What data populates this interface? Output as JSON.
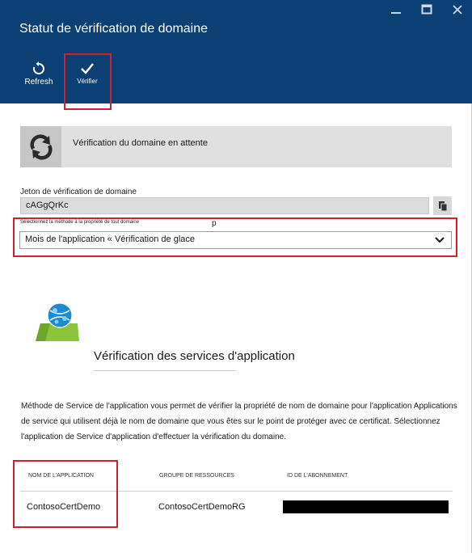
{
  "window": {
    "title": "Statut de vérification de domaine",
    "minimize_icon": "minimize-icon",
    "maximize_icon": "maximize-icon",
    "close_icon": "close-icon"
  },
  "toolbar": {
    "refresh_label": "Refresh",
    "refresh_icon": "refresh-icon",
    "verify_label": "Vérifier",
    "verify_icon": "checkmark-icon"
  },
  "status": {
    "icon": "sync-icon",
    "text": "Vérification du domaine en attente"
  },
  "token": {
    "label": "Jeton de vérification de domaine",
    "value": "cAGgQrKc",
    "copy_icon": "copy-icon"
  },
  "method": {
    "label": "Sélectionnez la méthode à la propriété de tout domaine",
    "stray_char": "p",
    "selected": "Mois de l'application « Vérification de glace",
    "chevron_icon": "chevron-down-icon"
  },
  "service": {
    "icon": "app-service-icon",
    "title": "Vérification des services d'application",
    "description": "Méthode de Service de l'application vous permet de vérifier la propriété de nom de domaine pour l'application Applications de service qui utilisent déjà le nom de domaine que vous êtes sur le point de protéger avec ce certificat. Sélectionnez l'application de Service d'application d'effectuer la vérification du domaine."
  },
  "table": {
    "headers": [
      "NOM DE L'APPLICATION",
      "GROUPE DE RESSOURCES",
      "ID DE L'ABONNEMENT"
    ],
    "rows": [
      [
        "ContosoCertDemo",
        "ContosoCertDemoRG",
        ""
      ]
    ]
  },
  "colors": {
    "header_bg": "#0c3f74",
    "highlight": "#d0202e",
    "status_bg": "#e0e0e0"
  }
}
